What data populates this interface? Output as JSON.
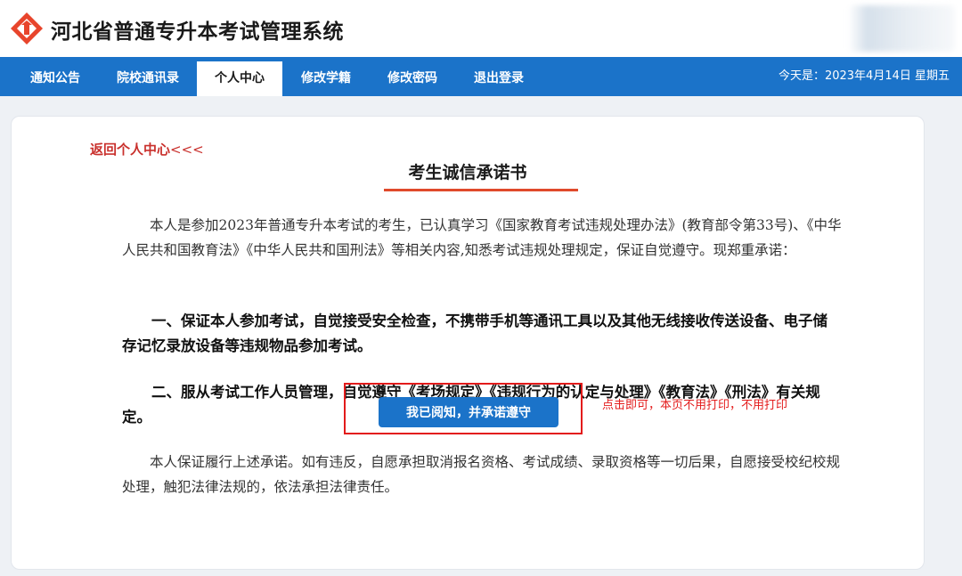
{
  "header": {
    "logo_icon": "hebei-exam-logo-icon",
    "site_title": "河北省普通专升本考试管理系统"
  },
  "nav": {
    "tabs": [
      {
        "label": "通知公告"
      },
      {
        "label": "院校通讯录"
      },
      {
        "label": "个人中心"
      },
      {
        "label": "修改学籍"
      },
      {
        "label": "修改密码"
      },
      {
        "label": "退出登录"
      }
    ],
    "active_tab": "个人中心",
    "today": "今天是：2023年4月14日 星期五"
  },
  "page": {
    "back_link": "返回个人中心",
    "back_arrows": "<<<",
    "title": "考生诚信承诺书",
    "paragraphs": [
      "本人是参加2023年普通专升本考试的考生，已认真学习《国家教育考试违规处理办法》(教育部令第33号)、《中华人民共和国教育法》《中华人民共和国刑法》等相关内容,知悉考试违规处理规定，保证自觉遵守。现郑重承诺：",
      "一、保证本人参加考试，自觉接受安全检查，不携带手机等通讯工具以及其他无线接收传送设备、电子储存记忆录放设备等违规物品参加考试。",
      "二、服从考试工作人员管理，自觉遵守《考场规定》《违规行为的认定与处理》《教育法》《刑法》有关规定。",
      "本人保证履行上述承诺。如有违反，自愿承担取消报名资格、考试成绩、录取资格等一切后果，自愿接受校纪校规处理，触犯法律法规的，依法承担法律责任。"
    ],
    "confirm_button": "我已阅知，并承诺遵守",
    "annotation": "点击即可，本页不用打印，不用打印"
  },
  "colors": {
    "nav_blue": "#1b73c9",
    "back_link_red": "#c9302c",
    "underline_red": "#e04a2b",
    "annotation_red": "#e31b1b"
  }
}
